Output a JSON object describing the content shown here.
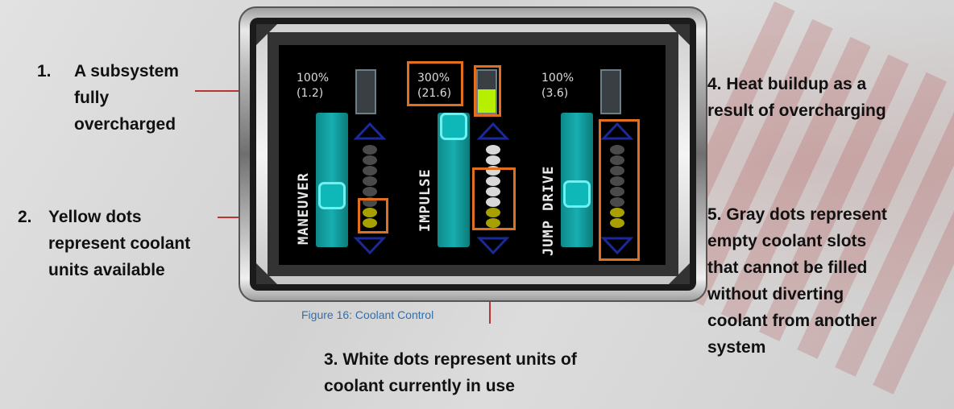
{
  "annotations": {
    "a1": {
      "number": "1.",
      "text_lines": [
        "A subsystem",
        "fully",
        "overcharged"
      ]
    },
    "a2": {
      "number": "2.",
      "text_lines": [
        "Yellow dots",
        "represent coolant",
        "units available"
      ]
    },
    "a3": {
      "text_lines": [
        "3. White dots represent units of",
        "coolant currently in use"
      ]
    },
    "a4": {
      "text_lines": [
        "4. Heat buildup as a",
        "result of overcharging"
      ]
    },
    "a5": {
      "text_lines": [
        "5. Gray dots represent",
        "empty coolant slots",
        "that cannot be filled",
        "without diverting",
        "coolant from another",
        "system"
      ]
    }
  },
  "caption": "Figure 16: Coolant Control",
  "subsystems": [
    {
      "name": "MANEUVER",
      "power": "100%",
      "value": "(1.2)",
      "heat_level": 0.0,
      "coolant_total": 8,
      "coolant_white": 0,
      "coolant_yellow": 2
    },
    {
      "name": "IMPULSE",
      "power": "300%",
      "value": "(21.6)",
      "heat_level": 0.55,
      "coolant_total": 8,
      "coolant_white": 6,
      "coolant_yellow": 2
    },
    {
      "name": "JUMP DRIVE",
      "power": "100%",
      "value": "(3.6)",
      "heat_level": 0.0,
      "coolant_total": 8,
      "coolant_white": 0,
      "coolant_yellow": 2
    }
  ],
  "colors": {
    "leader": "#b33333",
    "highlight": "#e07020",
    "caption": "#2f6fb0",
    "heat_fill": "#b6f000",
    "slider": "#18aeb0",
    "coolant_yellow": "#a8a000",
    "coolant_white": "#d8d8d8",
    "coolant_gray": "#4a4a4a",
    "arrow": "#1a2a9a"
  },
  "icons": {
    "up": "chevron-up-icon",
    "down": "chevron-down-icon"
  }
}
